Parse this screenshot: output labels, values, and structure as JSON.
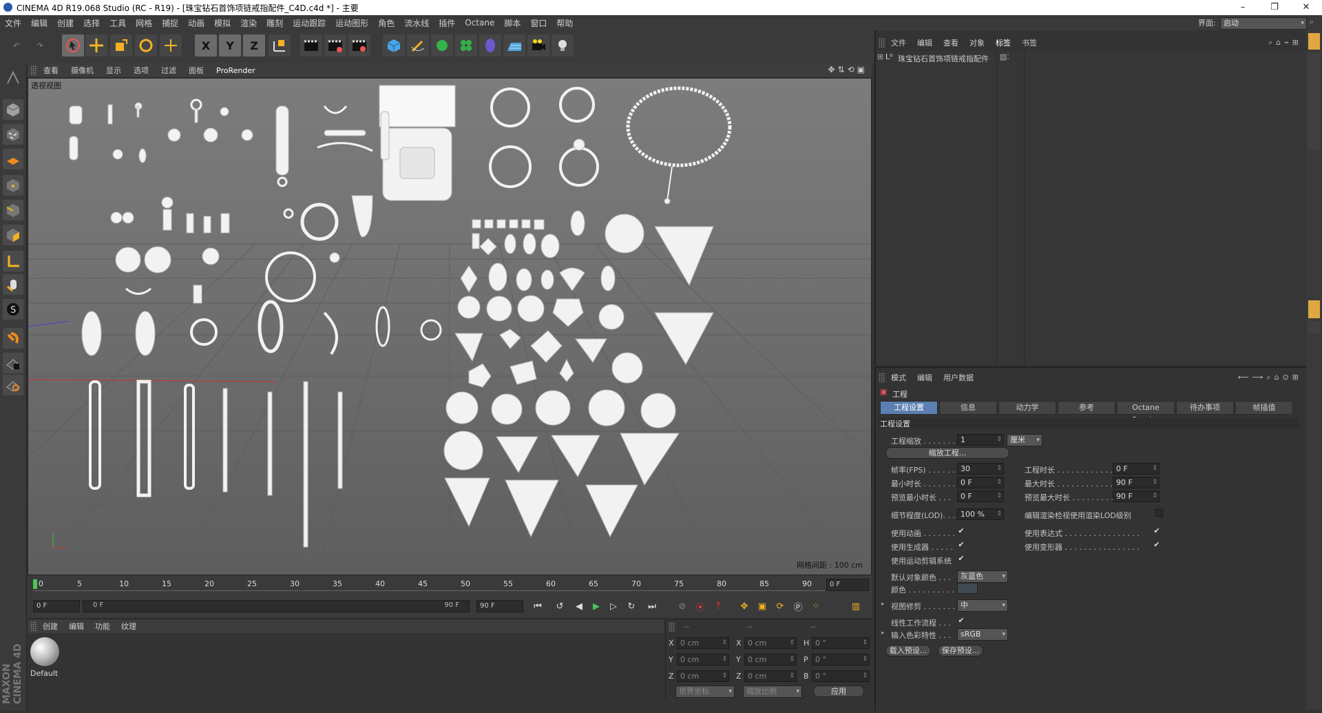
{
  "window": {
    "title": "CINEMA 4D R19.068 Studio (RC - R19) - [珠宝钻石首饰项链戒指配件_C4D.c4d *] - 主要"
  },
  "menu": [
    "文件",
    "编辑",
    "创建",
    "选择",
    "工具",
    "网格",
    "捕捉",
    "动画",
    "模拟",
    "渲染",
    "雕刻",
    "运动跟踪",
    "运动图形",
    "角色",
    "流水线",
    "插件",
    "Octane",
    "脚本",
    "窗口",
    "帮助"
  ],
  "layout": {
    "label": "界面:",
    "value": "启动"
  },
  "toolbar": {
    "axis_x": "X",
    "axis_y": "Y",
    "axis_z": "Z"
  },
  "viewport": {
    "menu": [
      "查看",
      "摄像机",
      "显示",
      "选项",
      "过滤",
      "面板",
      "ProRender"
    ],
    "name": "透视视图",
    "grid_spacing": "网格间距 : 100 cm"
  },
  "timeline": {
    "ticks": [
      "0",
      "5",
      "10",
      "15",
      "20",
      "25",
      "30",
      "35",
      "40",
      "45",
      "50",
      "55",
      "60",
      "65",
      "70",
      "75",
      "80",
      "85",
      "90"
    ],
    "current_frame": "0 F",
    "start_field": "0 F",
    "range_start": "0 F",
    "range_end": "90 F",
    "end_field": "90 F"
  },
  "material_manager": {
    "menu": [
      "创建",
      "编辑",
      "功能",
      "纹理"
    ],
    "material_name": "Default"
  },
  "coordinates": {
    "header": [
      "--",
      "--",
      "--"
    ],
    "rows": [
      {
        "a": "X",
        "a_val": "0 cm",
        "b": "X",
        "b_val": "0 cm",
        "c": "H",
        "c_val": "0 °"
      },
      {
        "a": "Y",
        "a_val": "0 cm",
        "b": "Y",
        "b_val": "0 cm",
        "c": "P",
        "c_val": "0 °"
      },
      {
        "a": "Z",
        "a_val": "0 cm",
        "b": "Z",
        "b_val": "0 cm",
        "c": "B",
        "c_val": "0 °"
      }
    ],
    "world_dropdown": "世界坐标",
    "scale_dropdown": "缩放比例",
    "apply_button": "应用"
  },
  "object_manager": {
    "menu": [
      "文件",
      "编辑",
      "查看",
      "对象",
      "标签",
      "书签"
    ],
    "object_name": "珠宝钻石首饰项链戒指配件"
  },
  "attribute_manager": {
    "menu": [
      "模式",
      "编辑",
      "用户数据"
    ],
    "heading": "工程",
    "tabs": [
      "工程设置",
      "信息",
      "动力学",
      "参考",
      "Octane Render",
      "待办事项",
      "帧插值"
    ],
    "section": "工程设置",
    "scale_label": "工程缩放 . . . . . . .",
    "scale_value": "1",
    "scale_unit": "厘米",
    "scale_button": "缩放工程...",
    "fps_label": "帧率(FPS) . . . . . .",
    "fps_value": "30",
    "duration_label": "工程时长 . . . . . . . . . . . . . . . . .",
    "duration_value": "0 F",
    "min_label": "最小时长 . . . . . . .",
    "min_value": "0 F",
    "max_label": "最大时长 . . . . . . . . . . . . . . . . .",
    "max_value": "90 F",
    "pmin_label": "预览最小时长 . . .",
    "pmin_value": "0 F",
    "pmax_label": "预览最大时长 . . . . . . . . . . . . . .",
    "pmax_value": "90 F",
    "lod_label": "细节程度(LOD). . .",
    "lod_value": "100 %",
    "lod_render_label": "编辑渲染检视使用渲染LOD级别",
    "anim_label": "使用动画 . . . . . . .",
    "expr_label": "使用表达式 . . . . . . . . . . . . . . . .",
    "gen_label": "使用生成器 . . . . .",
    "deform_label": "使用变形器 . . . . . . . . . . . . . . . .",
    "motion_label": "使用运动剪辑系统",
    "defcolor_label": "默认对象颜色 . . .",
    "defcolor_value": "灰蓝色",
    "color_label": "颜色 . . . . . . . . . .",
    "viewclip_label": "视图修剪 . . . . . . .",
    "viewclip_value": "中",
    "linear_label": "线性工作流程 . . .",
    "input_color_label": "输入色彩特性 . . .",
    "input_color_value": "sRGB",
    "load_preset": "载入预设...",
    "save_preset": "保存预设..."
  },
  "colors": {
    "accent": "#5b7fb0",
    "viewport_bg": "#6f6f6f",
    "panel_bg": "#333333"
  },
  "icons": [
    "undo-icon",
    "redo-icon",
    "select-arrow-icon",
    "move-icon",
    "scale-icon",
    "rotate-icon",
    "cube-icon",
    "pen-icon",
    "gear-icon",
    "camera-icon",
    "light-icon",
    "render-icon",
    "play-icon"
  ]
}
